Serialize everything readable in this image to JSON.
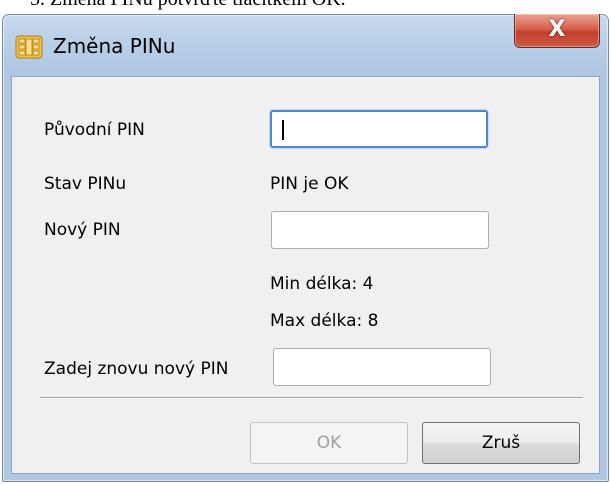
{
  "window": {
    "title": "Změna PINu",
    "close_glyph": "X"
  },
  "form": {
    "original_pin_label": "Původní PIN",
    "original_pin_value": "",
    "pin_status_label": "Stav PINu",
    "pin_status_value": "PIN je OK",
    "new_pin_label": "Nový PIN",
    "new_pin_value": "",
    "min_length": "Min délka: 4",
    "max_length": "Max délka: 8",
    "confirm_pin_label": "Zadej znovu nový PIN",
    "confirm_pin_value": ""
  },
  "buttons": {
    "ok_label": "OK",
    "cancel_label": "Zruš"
  },
  "icons": {
    "app": "smart-card-chip-icon",
    "close": "close-icon"
  },
  "colors": {
    "titlebar": "#b9cfe7",
    "close_button": "#c2402b",
    "focus_border": "#4a89d2",
    "dialog_background": "#f0f0f0"
  }
}
